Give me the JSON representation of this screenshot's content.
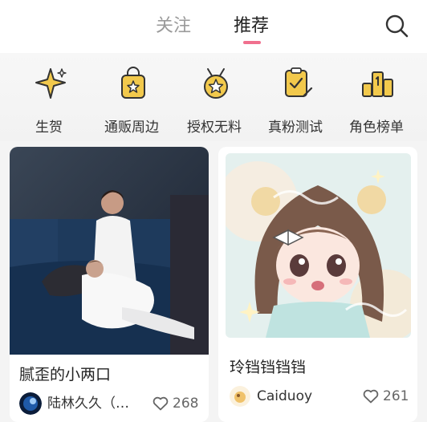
{
  "header": {
    "tabs": [
      {
        "label": "关注",
        "active": false
      },
      {
        "label": "推荐",
        "active": true
      }
    ],
    "search_icon": "search-icon"
  },
  "categories": [
    {
      "label": "生贺",
      "icon": "sparkle-icon"
    },
    {
      "label": "通贩周边",
      "icon": "shopping-bag-icon"
    },
    {
      "label": "授权无料",
      "icon": "medal-icon"
    },
    {
      "label": "真粉测试",
      "icon": "clipboard-check-icon"
    },
    {
      "label": "角色榜单",
      "icon": "ranking-icon"
    }
  ],
  "feed": [
    {
      "title": "腻歪的小两口",
      "author": "陆林久久（…",
      "likes": "268"
    },
    {
      "title": "玲铛铛铛铛",
      "author": "Caiduoy",
      "likes": "261"
    }
  ],
  "colors": {
    "accent": "#f0708e",
    "icon_gold": "#f2c94c",
    "icon_outline": "#333333"
  }
}
